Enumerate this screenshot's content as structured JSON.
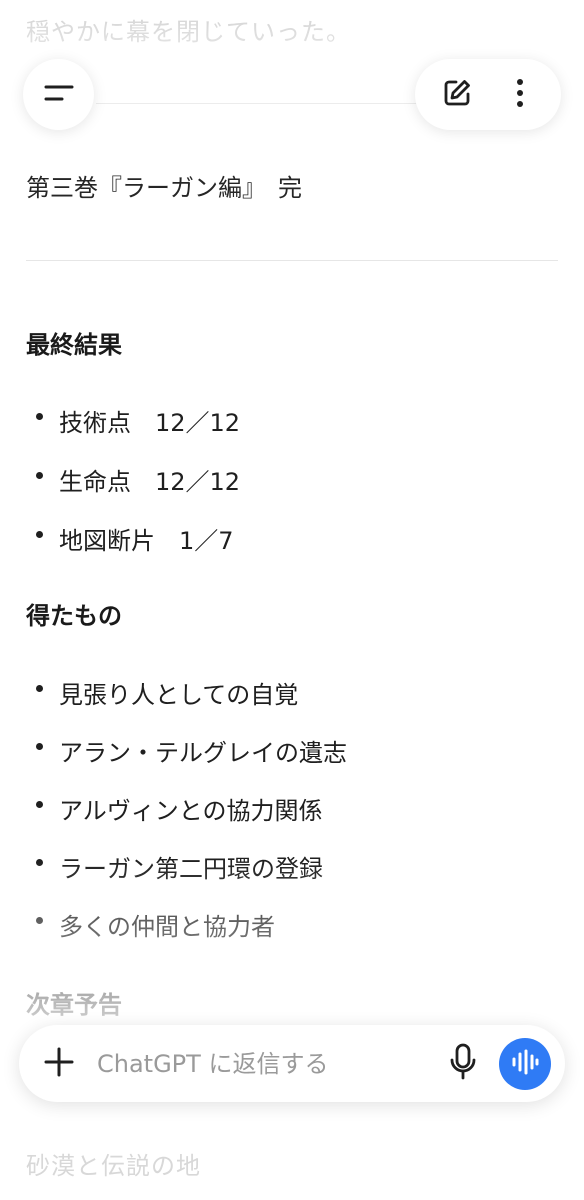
{
  "faded_top_text": "穏やかに幕を閉じていった。",
  "volume_title": "第三巻『ラーガン編』　完",
  "sections": {
    "final_results": {
      "heading": "最終結果",
      "items": [
        "技術点　12／12",
        "生命点　12／12",
        "地図断片　1／7"
      ]
    },
    "gains": {
      "heading": "得たもの",
      "items": [
        "見張り人としての自覚",
        "アラン・テルグレイの遺志",
        "アルヴィンとの協力関係",
        "ラーガン第二円環の登録",
        "多くの仲間と協力者"
      ]
    },
    "next_chapter": {
      "heading": "次章予告"
    }
  },
  "composer": {
    "placeholder": "ChatGPT に返信する",
    "value": ""
  },
  "faded_bottom_text": "砂漠と伝説の地",
  "icons": {
    "menu": "menu-icon",
    "new_chat": "edit-icon",
    "more": "more-vertical-icon",
    "plus": "plus-icon",
    "mic": "microphone-icon",
    "voice": "voice-waveform-icon"
  },
  "colors": {
    "accent": "#2f7bf5",
    "text": "#1f1f1f",
    "placeholder": "#9a9a9a"
  }
}
